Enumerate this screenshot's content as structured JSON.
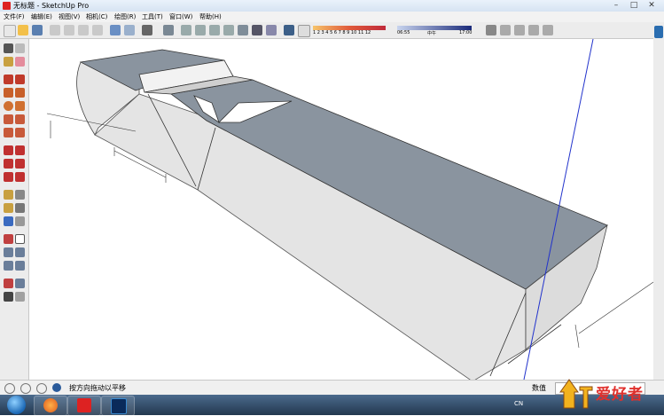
{
  "window": {
    "title": "无标题 - SketchUp Pro"
  },
  "menu": [
    "文件(F)",
    "编辑(E)",
    "视图(V)",
    "相机(C)",
    "绘图(R)",
    "工具(T)",
    "窗口(W)",
    "帮助(H)"
  ],
  "shadow_bar": {
    "months": "1 2 3 4 5 6 7 8 9 10 11 12",
    "time_start": "06:55",
    "time_mid": "中午",
    "time_end": "17:00"
  },
  "status": {
    "text": "按方向拖动以平移",
    "measure_label": "数值"
  },
  "taskbar": {
    "lang": "CN"
  },
  "watermark": {
    "text": "爱好者"
  },
  "colors": {
    "model_top": "#8a949f",
    "model_side": "#e4e4e4",
    "axis_blue": "#2233cc"
  }
}
